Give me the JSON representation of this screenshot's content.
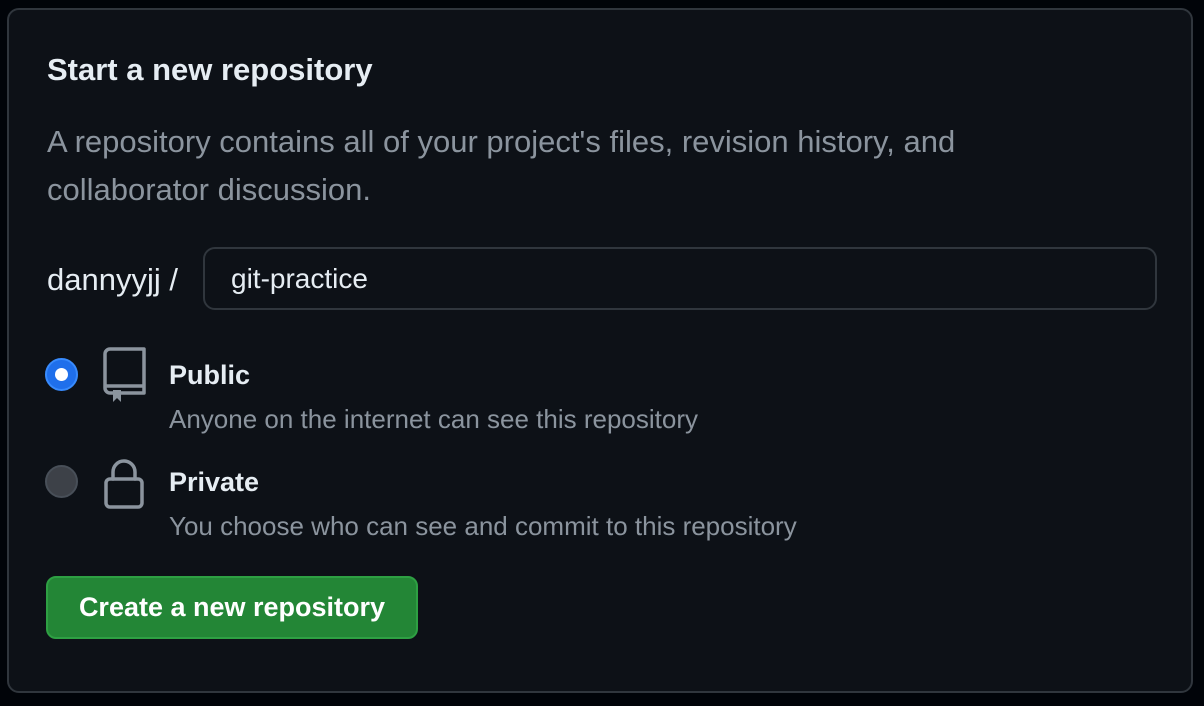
{
  "form": {
    "title": "Start a new repository",
    "description": "A repository contains all of your project's files, revision history, and collaborator discussion.",
    "owner_label": "dannyyjj /",
    "repo_name_value": "git-practice",
    "visibility_options": [
      {
        "label": "Public",
        "description": "Anyone on the internet can see this repository",
        "icon": "repo-icon",
        "selected": true
      },
      {
        "label": "Private",
        "description": "You choose who can see and commit to this repository",
        "icon": "lock-icon",
        "selected": false
      }
    ],
    "submit_label": "Create a new repository"
  },
  "colors": {
    "background": "#0d1117",
    "border": "#30363d",
    "text_primary": "#e6edf3",
    "text_muted": "#8b949e",
    "radio_selected": "#1f6feb",
    "button_green": "#238636"
  }
}
